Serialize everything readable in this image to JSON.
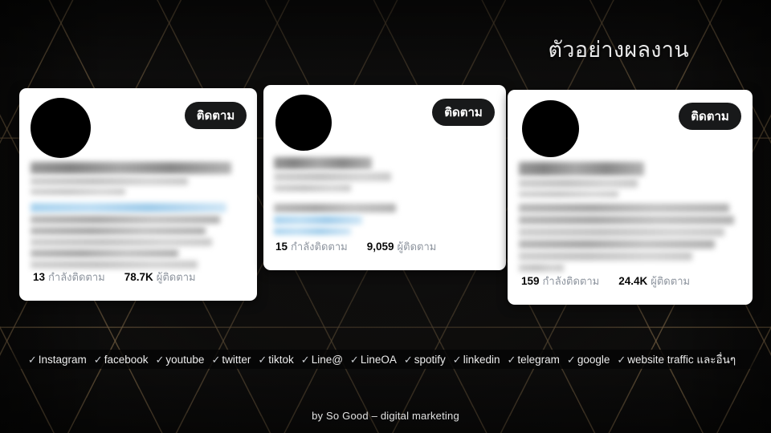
{
  "page": {
    "title": "ตัวอย่างผลงาน",
    "background_color": "#0f0e0d",
    "accent_color": "#c0a070"
  },
  "cards": [
    {
      "follow_button_label": "ติดตาม",
      "following_count": "13",
      "following_label": "กำลังติดตาม",
      "followers_count": "78.7K",
      "followers_label": "ผู้ติดตาม"
    },
    {
      "follow_button_label": "ติดตาม",
      "following_count": "15",
      "following_label": "กำลังติดตาม",
      "followers_count": "9,059",
      "followers_label": "ผู้ติดตาม"
    },
    {
      "follow_button_label": "ติดตาม",
      "following_count": "159",
      "following_label": "กำลังติดตาม",
      "followers_count": "24.4K",
      "followers_label": "ผู้ติดตาม"
    }
  ],
  "platforms": [
    {
      "check": "✓",
      "name": "Instagram"
    },
    {
      "check": "✓",
      "name": "facebook"
    },
    {
      "check": "✓",
      "name": "youtube"
    },
    {
      "check": "✓",
      "name": "twitter"
    },
    {
      "check": "✓",
      "name": "tiktok"
    },
    {
      "check": "✓",
      "name": "Line@"
    },
    {
      "check": "✓",
      "name": "LineOA"
    },
    {
      "check": "✓",
      "name": "spotify"
    },
    {
      "check": "✓",
      "name": "linkedin"
    },
    {
      "check": "✓",
      "name": "telegram"
    },
    {
      "check": "✓",
      "name": "google"
    },
    {
      "check": "✓",
      "name": "website traffic และอื่นๆ"
    }
  ],
  "footer": {
    "credit": "by So Good – digital marketing"
  }
}
